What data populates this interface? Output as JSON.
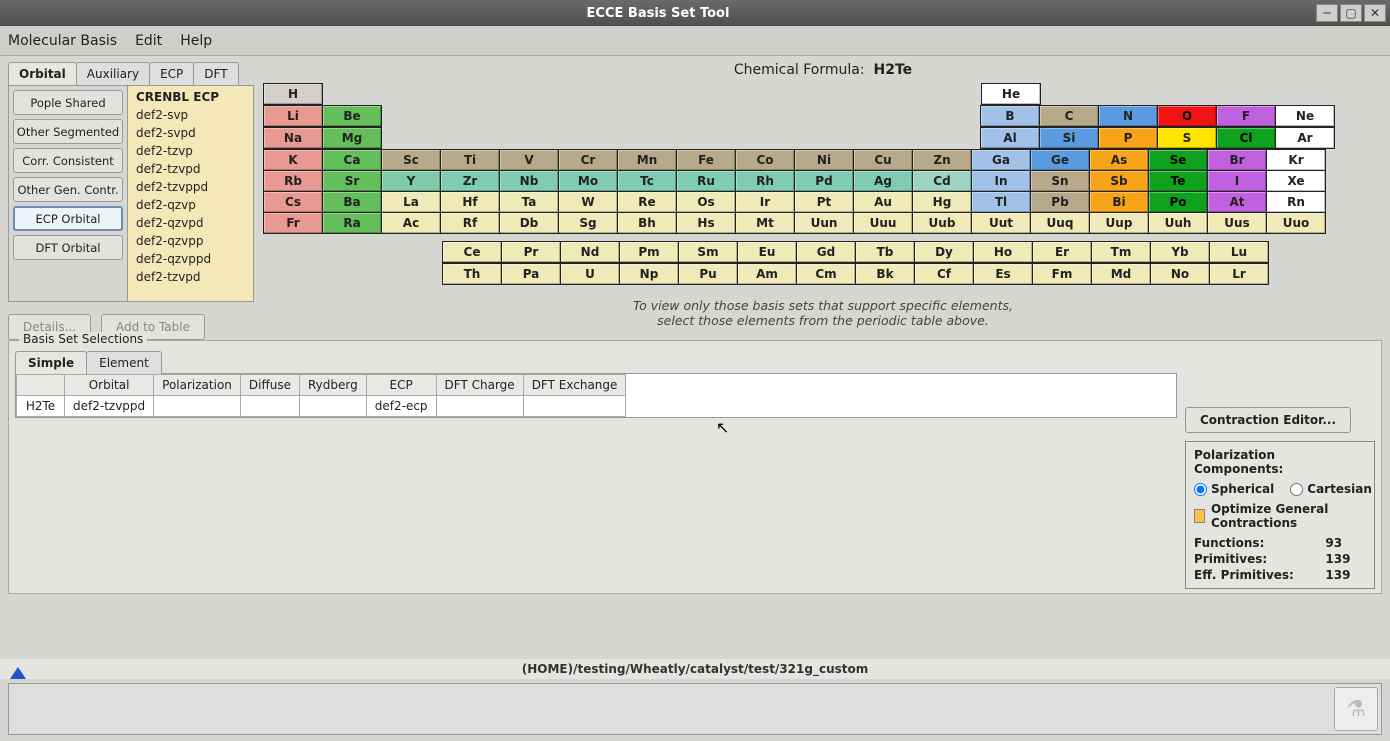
{
  "window": {
    "title": "ECCE Basis Set Tool"
  },
  "menu": {
    "molecular_basis": "Molecular Basis",
    "edit": "Edit",
    "help": "Help"
  },
  "tabs_top": {
    "orbital": "Orbital",
    "auxiliary": "Auxiliary",
    "ecp": "ECP",
    "dft": "DFT"
  },
  "categories": {
    "pople_shared": "Pople Shared",
    "other_segmented": "Other Segmented",
    "corr_consistent": "Corr. Consistent",
    "other_gen_contr": "Other Gen. Contr.",
    "ecp_orbital": "ECP Orbital",
    "dft_orbital": "DFT Orbital"
  },
  "basis_sets": [
    "CRENBL ECP",
    "def2-svp",
    "def2-svpd",
    "def2-tzvp",
    "def2-tzvpd",
    "def2-tzvppd",
    "def2-qzvp",
    "def2-qzvpd",
    "def2-qzvpp",
    "def2-qzvppd",
    "def2-tzvpd"
  ],
  "basis_selected": "CRENBL ECP",
  "buttons": {
    "details": "Details...",
    "add_to_table": "Add to Table",
    "contraction": "Contraction Editor..."
  },
  "formula": {
    "label": "Chemical Formula:",
    "value": "H2Te"
  },
  "periodic": {
    "r1": [
      [
        "H",
        "c-gray"
      ],
      [
        "..s",
        "11"
      ],
      [
        "He",
        "c-white"
      ]
    ],
    "r2": [
      [
        "Li",
        "c-pink"
      ],
      [
        "Be",
        "c-green"
      ],
      [
        "..s",
        "10"
      ],
      [
        "B",
        "c-lblue"
      ],
      [
        "C",
        "c-tan"
      ],
      [
        "N",
        "c-blue2"
      ],
      [
        "O",
        "c-red"
      ],
      [
        "F",
        "c-purple"
      ],
      [
        "Ne",
        "c-white"
      ]
    ],
    "r3": [
      [
        "Na",
        "c-pink"
      ],
      [
        "Mg",
        "c-green"
      ],
      [
        "..s",
        "10"
      ],
      [
        "Al",
        "c-lblue"
      ],
      [
        "Si",
        "c-blue2"
      ],
      [
        "P",
        "c-orange"
      ],
      [
        "S",
        "c-yellow"
      ],
      [
        "Cl",
        "c-dkgreen"
      ],
      [
        "Ar",
        "c-white"
      ]
    ],
    "r4": [
      [
        "K",
        "c-pink"
      ],
      [
        "Ca",
        "c-green"
      ],
      [
        "Sc",
        "c-tan"
      ],
      [
        "Ti",
        "c-tan"
      ],
      [
        "V",
        "c-tan"
      ],
      [
        "Cr",
        "c-tan"
      ],
      [
        "Mn",
        "c-tan"
      ],
      [
        "Fe",
        "c-tan"
      ],
      [
        "Co",
        "c-tan"
      ],
      [
        "Ni",
        "c-tan"
      ],
      [
        "Cu",
        "c-tan"
      ],
      [
        "Zn",
        "c-tan"
      ],
      [
        "Ga",
        "c-lblue"
      ],
      [
        "Ge",
        "c-blue2"
      ],
      [
        "As",
        "c-orange"
      ],
      [
        "Se",
        "c-dkgreen"
      ],
      [
        "Br",
        "c-purple"
      ],
      [
        "Kr",
        "c-white"
      ]
    ],
    "r5": [
      [
        "Rb",
        "c-pink"
      ],
      [
        "Sr",
        "c-green"
      ],
      [
        "Y",
        "c-teal1"
      ],
      [
        "Zr",
        "c-teal2"
      ],
      [
        "Nb",
        "c-teal2"
      ],
      [
        "Mo",
        "c-teal2"
      ],
      [
        "Tc",
        "c-teal2"
      ],
      [
        "Ru",
        "c-teal2"
      ],
      [
        "Rh",
        "c-teal2"
      ],
      [
        "Pd",
        "c-teal2"
      ],
      [
        "Ag",
        "c-teal2"
      ],
      [
        "Cd",
        "c-lteal"
      ],
      [
        "In",
        "c-lblue"
      ],
      [
        "Sn",
        "c-tan"
      ],
      [
        "Sb",
        "c-orange"
      ],
      [
        "Te",
        "c-dkgreen"
      ],
      [
        "I",
        "c-purple"
      ],
      [
        "Xe",
        "c-white"
      ]
    ],
    "r6": [
      [
        "Cs",
        "c-pink"
      ],
      [
        "Ba",
        "c-green"
      ],
      [
        "La",
        "c-cream"
      ],
      [
        "Hf",
        "c-cream"
      ],
      [
        "Ta",
        "c-cream"
      ],
      [
        "W",
        "c-cream"
      ],
      [
        "Re",
        "c-cream"
      ],
      [
        "Os",
        "c-cream"
      ],
      [
        "Ir",
        "c-cream"
      ],
      [
        "Pt",
        "c-cream"
      ],
      [
        "Au",
        "c-cream"
      ],
      [
        "Hg",
        "c-cream"
      ],
      [
        "Tl",
        "c-lblue"
      ],
      [
        "Pb",
        "c-tan"
      ],
      [
        "Bi",
        "c-orange"
      ],
      [
        "Po",
        "c-dkgreen"
      ],
      [
        "At",
        "c-purple"
      ],
      [
        "Rn",
        "c-white"
      ]
    ],
    "r7": [
      [
        "Fr",
        "c-pink"
      ],
      [
        "Ra",
        "c-green"
      ],
      [
        "Ac",
        "c-cream"
      ],
      [
        "Rf",
        "c-cream"
      ],
      [
        "Db",
        "c-cream"
      ],
      [
        "Sg",
        "c-cream"
      ],
      [
        "Bh",
        "c-cream"
      ],
      [
        "Hs",
        "c-cream"
      ],
      [
        "Mt",
        "c-cream"
      ],
      [
        "Uun",
        "c-cream"
      ],
      [
        "Uuu",
        "c-cream"
      ],
      [
        "Uub",
        "c-cream"
      ],
      [
        "Uut",
        "c-cream"
      ],
      [
        "Uuq",
        "c-cream"
      ],
      [
        "Uup",
        "c-cream"
      ],
      [
        "Uuh",
        "c-cream"
      ],
      [
        "Uus",
        "c-cream"
      ],
      [
        "Uuo",
        "c-cream"
      ]
    ],
    "r8": [
      [
        "..s",
        "3"
      ],
      [
        "Ce",
        "c-cream"
      ],
      [
        "Pr",
        "c-cream"
      ],
      [
        "Nd",
        "c-cream"
      ],
      [
        "Pm",
        "c-cream"
      ],
      [
        "Sm",
        "c-cream"
      ],
      [
        "Eu",
        "c-cream"
      ],
      [
        "Gd",
        "c-cream"
      ],
      [
        "Tb",
        "c-cream"
      ],
      [
        "Dy",
        "c-cream"
      ],
      [
        "Ho",
        "c-cream"
      ],
      [
        "Er",
        "c-cream"
      ],
      [
        "Tm",
        "c-cream"
      ],
      [
        "Yb",
        "c-cream"
      ],
      [
        "Lu",
        "c-cream"
      ]
    ],
    "r9": [
      [
        "..s",
        "3"
      ],
      [
        "Th",
        "c-cream"
      ],
      [
        "Pa",
        "c-cream"
      ],
      [
        "U",
        "c-cream"
      ],
      [
        "Np",
        "c-cream"
      ],
      [
        "Pu",
        "c-cream"
      ],
      [
        "Am",
        "c-cream"
      ],
      [
        "Cm",
        "c-cream"
      ],
      [
        "Bk",
        "c-cream"
      ],
      [
        "Cf",
        "c-cream"
      ],
      [
        "Es",
        "c-cream"
      ],
      [
        "Fm",
        "c-cream"
      ],
      [
        "Md",
        "c-cream"
      ],
      [
        "No",
        "c-cream"
      ],
      [
        "Lr",
        "c-cream"
      ]
    ]
  },
  "note": {
    "l1": "To view only those basis sets that support specific elements,",
    "l2": "select those elements from the periodic table above."
  },
  "bss": {
    "frame": "Basis Set Selections",
    "tab_simple": "Simple",
    "tab_element": "Element",
    "headers": [
      "",
      "Orbital",
      "Polarization",
      "Diffuse",
      "Rydberg",
      "ECP",
      "DFT Charge",
      "DFT Exchange"
    ],
    "row": {
      "name": "H2Te",
      "orbital": "def2-tzvppd",
      "polarization": "",
      "diffuse": "",
      "rydberg": "",
      "ecp": "def2-ecp",
      "dft_charge": "",
      "dft_exchange": ""
    }
  },
  "pol": {
    "header": "Polarization Components:",
    "spherical": "Spherical",
    "cartesian": "Cartesian",
    "optimize": "Optimize General Contractions",
    "functions_l": "Functions:",
    "functions_v": "93",
    "primitives_l": "Primitives:",
    "primitives_v": "139",
    "effprim_l": "Eff. Primitives:",
    "effprim_v": "139"
  },
  "status": {
    "path": "(HOME)/testing/Wheatly/catalyst/test/321g_custom"
  }
}
